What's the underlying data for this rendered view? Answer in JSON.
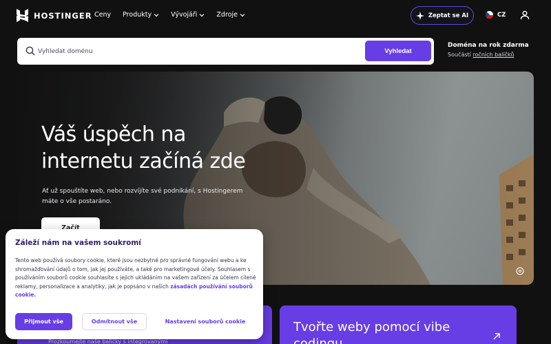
{
  "nav": {
    "logo_text": "HOSTINGER",
    "menu": [
      {
        "label": "Ceny",
        "has_dropdown": false
      },
      {
        "label": "Produkty",
        "has_dropdown": true
      },
      {
        "label": "Vývojáři",
        "has_dropdown": true
      },
      {
        "label": "Zdroje",
        "has_dropdown": true
      }
    ],
    "ai_button_label": "Zeptat se AI",
    "language_label": "CZ",
    "icons": [
      "hostinger-logo-icon",
      "chevron-down-icon",
      "ai-sparkle-icon",
      "czech-flag-icon",
      "user-icon"
    ]
  },
  "search": {
    "placeholder": "Vyhledat doménu",
    "button_label": "Vyhledat",
    "icon": "search-icon"
  },
  "promo": {
    "title": "Doména na rok zdarma",
    "subtitle_prefix": "Součástí",
    "subtitle_link": "ročních balíčků"
  },
  "hero": {
    "title": "Váš úspěch na internetu začíná zde",
    "text": "Ať už spouštíte web, nebo rozvíjíte své podnikání, s Hostingerem máte o vše postaráno.",
    "button_label": "Začít",
    "pause_icon": "pause-icon"
  },
  "cards": {
    "left_text": "Prozkoumejte naše balíčky s integrovanými",
    "right_title": "Tvořte weby pomocí vibe codingu"
  },
  "cookie": {
    "title": "Záleží nám na vašem soukromí",
    "text": "Tento web používá soubory cookie, které jsou nezbytné pro správné fungování webu a ke shromažďování údajů o tom, jak jej používáte, a také pro marketingové účely. Souhlasem s používáním souborů cookie souhlasíte s jejich ukládáním na vašem zařízení za účelem cílené reklamy, personalizace a analytiky, jak je popsáno v našich",
    "link_text": "zásadách používání souborů cookie.",
    "accept_label": "Přijmout vše",
    "reject_label": "Odmítnout vše",
    "settings_label": "Nastavení souborů cookie"
  },
  "colors": {
    "background": "#111112",
    "accent": "#673de6",
    "white": "#ffffff"
  }
}
